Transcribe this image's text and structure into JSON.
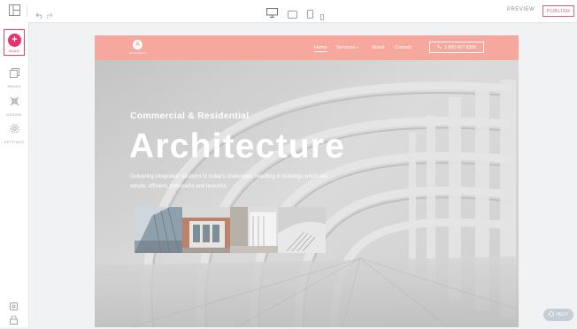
{
  "toolbar": {
    "undo_icon": "undo-icon",
    "redo_icon": "redo-icon",
    "devices": [
      "desktop-icon",
      "tablet-landscape-icon",
      "tablet-portrait-icon",
      "mobile-icon"
    ],
    "preview_label": "PREVIEW",
    "publish_label": "PUBLISH"
  },
  "sidebar": {
    "items": [
      {
        "label": "BUILD",
        "icon": "plus-icon",
        "active": true
      },
      {
        "label": "PAGES",
        "icon": "pages-icon"
      },
      {
        "label": "DESIGN",
        "icon": "design-icon"
      },
      {
        "label": "SETTINGS",
        "icon": "gear-icon"
      }
    ]
  },
  "site": {
    "logo_letter": "A",
    "logo_text": "ARCHITECT",
    "nav": {
      "home": "Home",
      "services": "Services",
      "about": "About",
      "contact": "Contact"
    },
    "phone": "1-800-567-8909",
    "hero": {
      "kicker": "Commercial & Residential",
      "title": "Architecture",
      "subtitle": "Delivering integrated solutions to today's challenges, resulting in buildings which are simple, efficient, purposeful and beautiful."
    }
  },
  "help": {
    "label": "HELP"
  },
  "colors": {
    "accent": "#e8336a",
    "header": "#f7a89e"
  }
}
